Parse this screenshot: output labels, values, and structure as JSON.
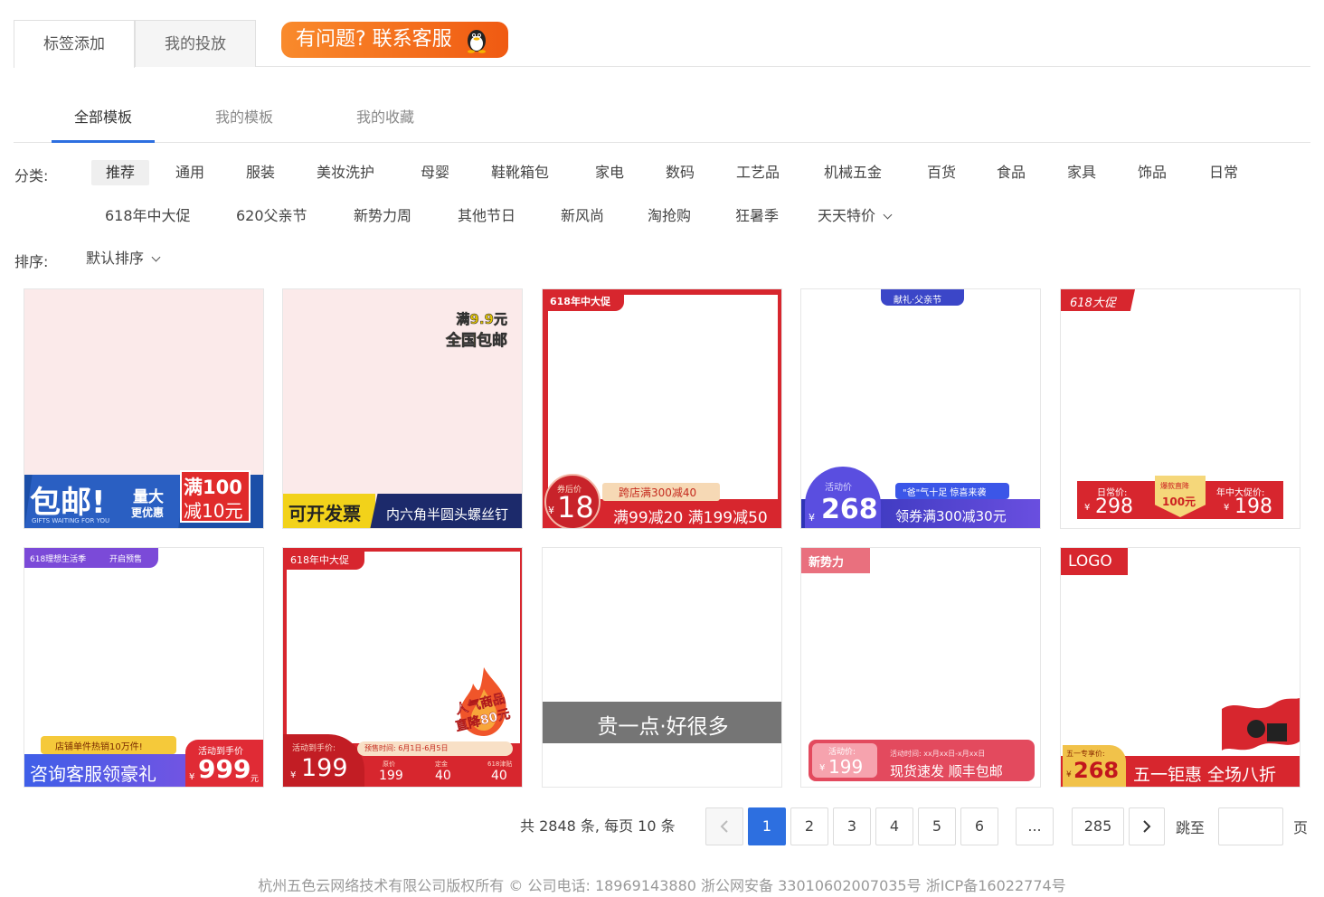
{
  "top_tabs": {
    "tag_add": "标签添加",
    "my_launch": "我的投放"
  },
  "support": {
    "label": "有问题? 联系客服"
  },
  "sub_tabs": {
    "all": "全部模板",
    "mine": "我的模板",
    "fav": "我的收藏"
  },
  "filters": {
    "category_label": "分类:",
    "categories_row1": [
      "推荐",
      "通用",
      "服装",
      "美妆洗护",
      "母婴",
      "鞋靴箱包",
      "家电",
      "数码",
      "工艺品",
      "机械五金",
      "百货",
      "食品",
      "家具",
      "饰品",
      "日常"
    ],
    "categories_row2": [
      "618年中大促",
      "620父亲节",
      "新势力周",
      "其他节日",
      "新风尚",
      "淘抢购",
      "狂暑季",
      "天天特价"
    ],
    "active_category": "推荐",
    "sort_label": "排序:",
    "sort_value": "默认排序"
  },
  "cards": {
    "c1": {
      "main": "包邮!",
      "sub": "GIFTS WAITING FOR YOU",
      "tag1": "量大",
      "tag2": "更优惠",
      "box1": "满100",
      "box2": "减10元"
    },
    "c2": {
      "top1": "满9.9元",
      "top2": "全国包邮",
      "left": "可开发票",
      "right": "内六角半圆头螺丝钉"
    },
    "c3": {
      "corner": "618年中大促",
      "badge_label": "券后价",
      "price": "18",
      "currency": "¥",
      "promo_top": "跨店满300减40",
      "promo": "满99减20 满199减50"
    },
    "c4": {
      "top": "献礼·父亲节",
      "badge_label": "活动价",
      "currency": "¥",
      "price": "268",
      "chip": "\"爸\"气十足 惊喜来袭",
      "bottom": "领券满300减30元"
    },
    "c5": {
      "corner": "618大促",
      "l_label": "日常价:",
      "l_price": "298",
      "m_label": "爆款直降",
      "m_value": "100元",
      "r_label": "年中大促价:",
      "r_price": "198",
      "currency": "¥"
    },
    "c6": {
      "corner": "618理想生活季",
      "corner2": "开启预售",
      "ribbon": "店铺单件热销10万件!",
      "main": "咨询客服领豪礼",
      "price_label": "活动到手价",
      "price": "999",
      "currency": "¥",
      "unit": "元"
    },
    "c7": {
      "corner": "618年中大促",
      "fire1": "人气商品",
      "fire2": "直降80元",
      "label": "活动到手价:",
      "currency": "¥",
      "price": "199",
      "presale": "预售时间: 6月1日-6月5日",
      "p1_label": "原价",
      "p1": "199",
      "p2_label": "定金",
      "p2": "40",
      "p3_label": "618津贴",
      "p3": "40"
    },
    "c8": {
      "band": "贵一点·好很多"
    },
    "c9": {
      "corner": "新势力",
      "label": "活动价:",
      "currency": "¥",
      "price": "199",
      "time": "活动时间: xx月xx日-x月xx日",
      "main": "现货速发 顺丰包邮"
    },
    "c10": {
      "logo": "LOGO",
      "label": "五一专享价:",
      "currency": "¥",
      "price": "268",
      "main": "五一钜惠 全场八折"
    }
  },
  "pagination": {
    "total": "共 2848 条, 每页 10 条",
    "pages": [
      "1",
      "2",
      "3",
      "4",
      "5",
      "6"
    ],
    "ellipsis": "...",
    "last": "285",
    "jump": "跳至",
    "page_unit": "页"
  },
  "footer": {
    "text": "杭州五色云网络技术有限公司版权所有 © 公司电话: 18969143880  浙公网安备 33010602007035号  浙ICP备16022774号"
  },
  "colors": {
    "accent": "#2d6fe0",
    "support_start": "#f98a2c",
    "support_end": "#f05a12",
    "promo_red": "#d7262e"
  }
}
